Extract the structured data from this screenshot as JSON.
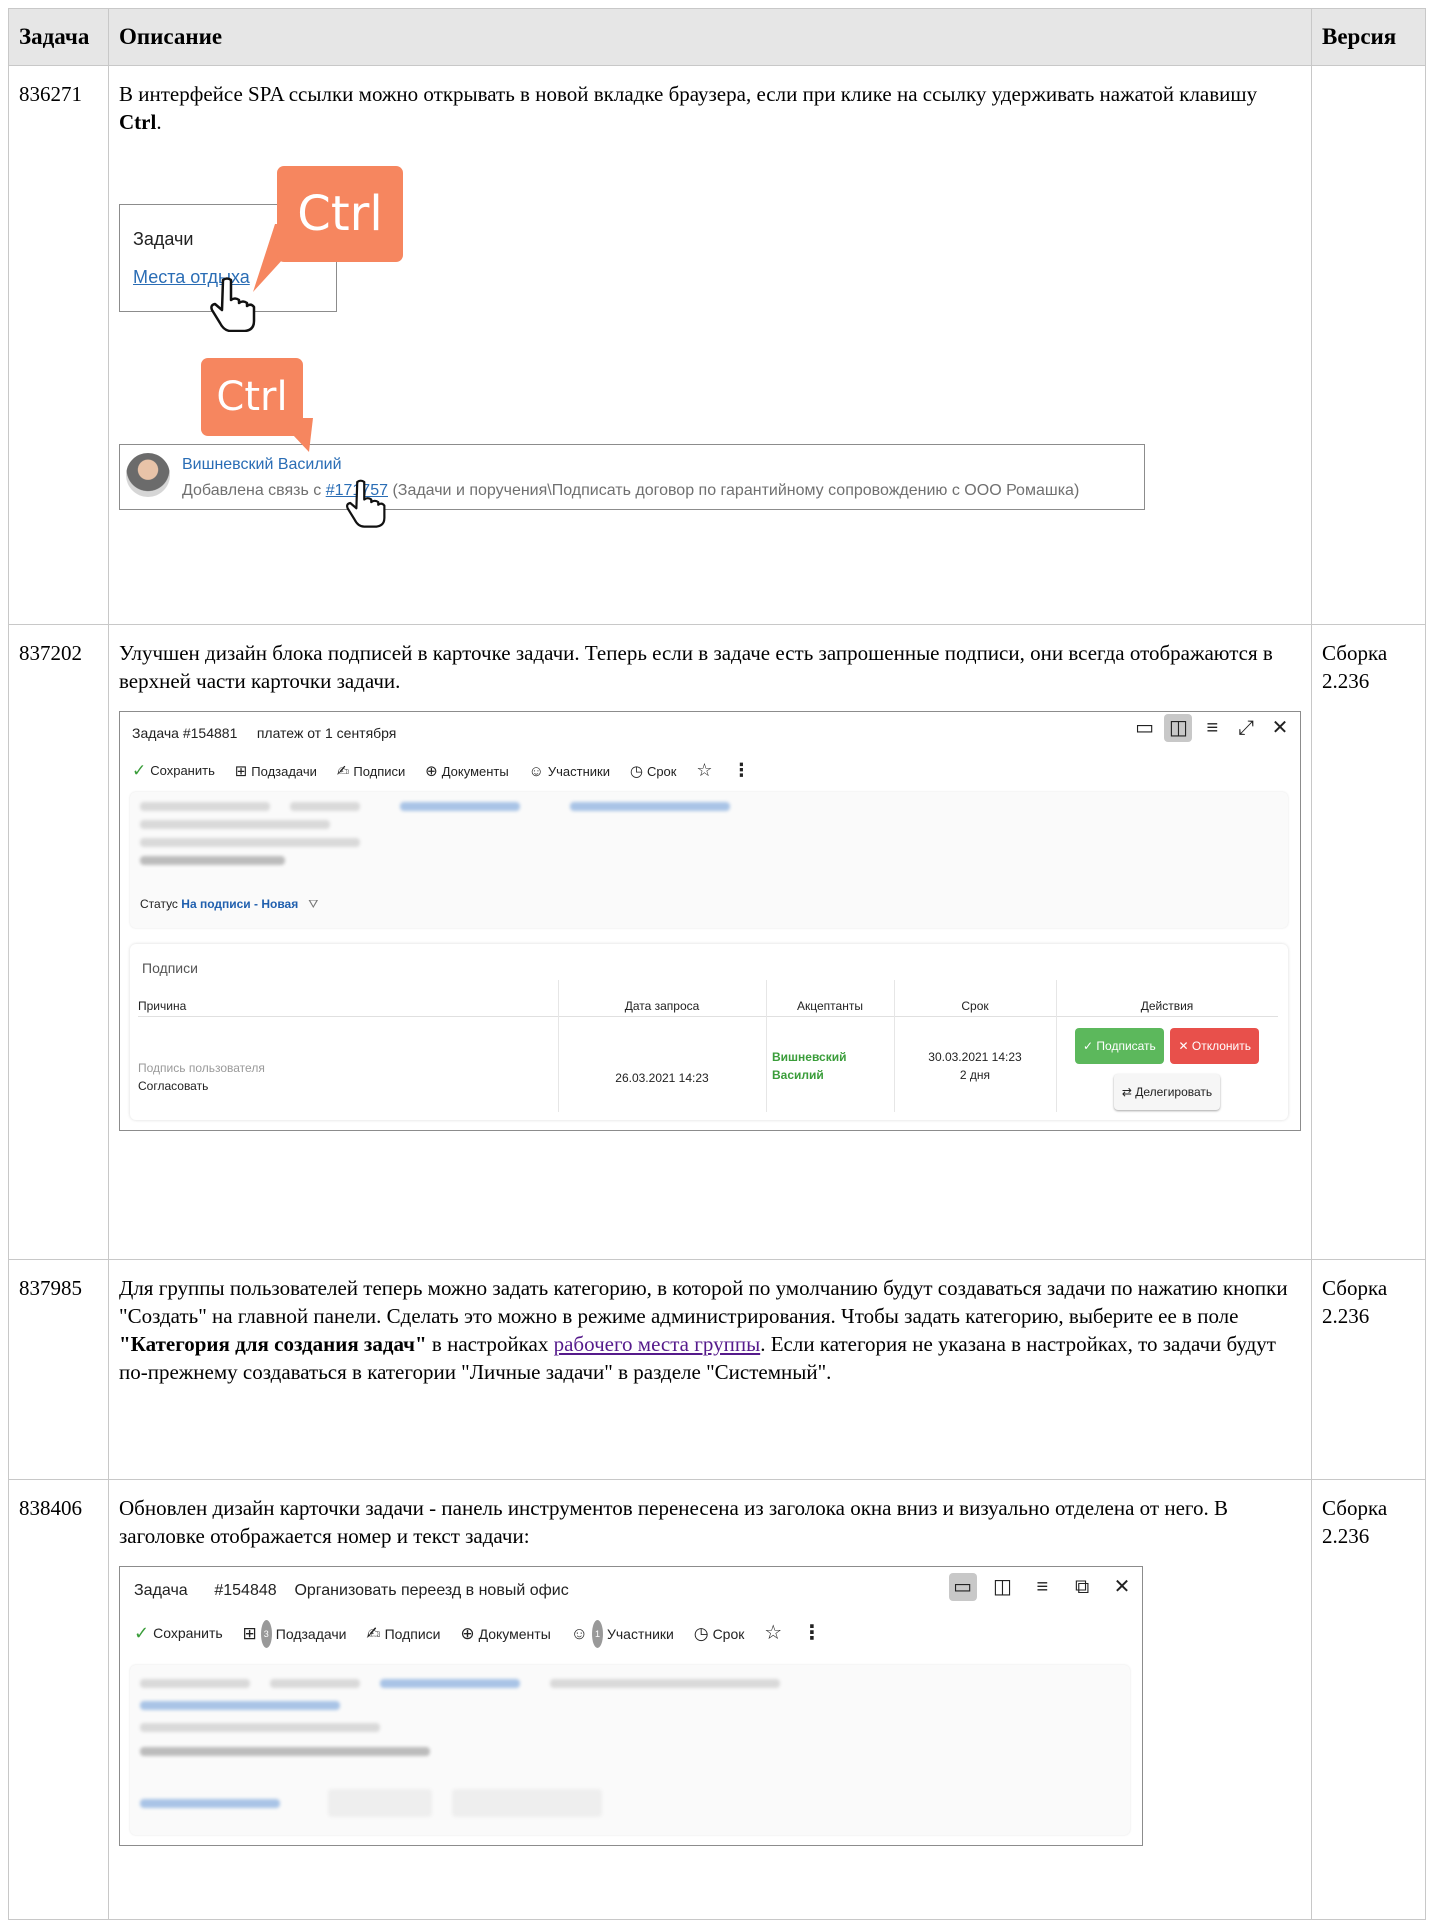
{
  "headers": {
    "task": "Задача",
    "desc": "Описание",
    "version": "Версия"
  },
  "rows": [
    {
      "id": "836271",
      "version": "",
      "text_before": "В интерфейсе SPA ссылки можно открывать в новой вкладке браузера, если при клике на ссылку удерживать нажатой клавишу ",
      "text_bold": "Ctrl",
      "text_after": ".",
      "fig1": {
        "callout": "Ctrl",
        "title": "Задачи",
        "link": "Места отдыха"
      },
      "fig2": {
        "callout": "Ctrl",
        "name": "Вишневский Василий",
        "text_prefix": "Добавлена связь с ",
        "link": "#171757",
        "text_suffix": " (Задачи и поручения\\Подписать договор по гарантийному сопровождению с ООО Ромашка)"
      }
    },
    {
      "id": "837202",
      "version": "Сборка 2.236",
      "text": "Улучшен дизайн блока подписей в карточке задачи. Теперь если в задаче есть запрошенные подписи, они всегда отображаются в верхней части карточки задачи.",
      "card": {
        "task_no": "Задача #154881",
        "task_title": "платеж от 1 сентября",
        "toolbar": [
          "Сохранить",
          "Подзадачи",
          "Подписи",
          "Документы",
          "Участники",
          "Срок"
        ],
        "status_label": "Статус",
        "status_value": "На подписи - Новая",
        "sign_title": "Подписи",
        "cols": [
          "Причина",
          "Дата запроса",
          "Акцептанты",
          "Срок",
          "Действия"
        ],
        "reason_sub": "Подпись пользователя",
        "reason": "Согласовать",
        "date": "26.03.2021 14:23",
        "acceptant": "Вишневский Василий",
        "due": "30.03.2021 14:23",
        "due_sub": "2 дня",
        "btn_sign": "✓ Подписать",
        "btn_reject": "✕ Отклонить",
        "btn_delegate": "⇄ Делегировать"
      }
    },
    {
      "id": "837985",
      "version": "Сборка 2.236",
      "text_a": "Для группы пользователей теперь можно задать категорию, в которой по умолчанию будут создаваться задачи по нажатию кнопки \"Создать\" на главной панели. Сделать это можно в режиме администрирования. Чтобы задать категорию, выберите ее в поле ",
      "text_bold": "\"Категория для создания задач\"",
      "text_b": " в настройках ",
      "link": "рабочего места группы",
      "text_c": ". Если категория не указана в настройках, то задачи будут по-прежнему создаваться в категории \"Личные задачи\" в разделе \"Системный\"."
    },
    {
      "id": "838406",
      "version": "Сборка 2.236",
      "text": "Обновлен дизайн карточки задачи - панель инструментов перенесена из заголока окна вниз и визуально отделена от него. В заголовке отображается номер и текст задачи:",
      "card": {
        "label": "Задача",
        "task_no": "#154848",
        "task_title": "Организовать переезд в новый офис",
        "toolbar": [
          "Сохранить",
          "Подзадачи",
          "Подписи",
          "Документы",
          "Участники",
          "Срок"
        ],
        "badge_sub": "3",
        "badge_part": "1"
      }
    }
  ]
}
